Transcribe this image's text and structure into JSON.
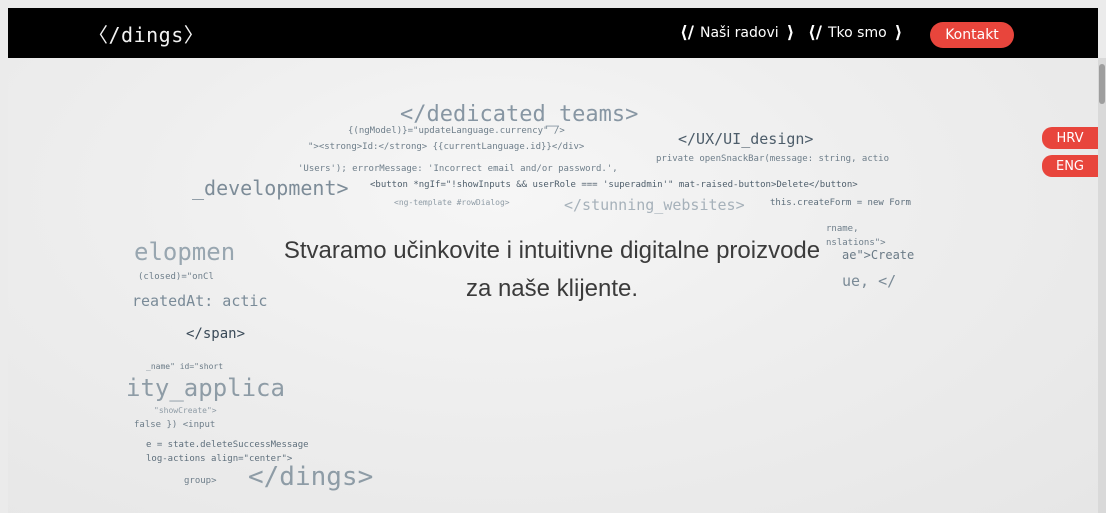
{
  "header": {
    "logo": "〈/dings〉",
    "nav": [
      {
        "prefix": "⟨/",
        "label": "Naši radovi",
        "suffix": "⟩"
      },
      {
        "prefix": "⟨/",
        "label": "Tko smo",
        "suffix": "⟩"
      }
    ],
    "contact_label": "Kontakt"
  },
  "hero": {
    "tagline": "Stvaramo učinkovite i intuitivne digitalne proizvode za naše klijente.",
    "code": {
      "dedicated_teams": "</dedicated_teams>",
      "ux_design": "</UX/UI_design>",
      "development": "_development>",
      "stunning_websites": "</stunning_websites>",
      "developmen": "elopmen",
      "created_at": "reatedAt: actic",
      "span": "</span>",
      "quality": "ity_applica",
      "dings": "</dings>",
      "line1": "{(ngModel)}=\"updateLanguage.currency\" />",
      "line2": "\"><strong>Id:</strong> {{currentLanguage.id}}</div>",
      "line3": "'Users'); errorMessage: 'Incorrect email and/or password.',",
      "line4": "<button *ngIf=\"!showInputs && userRole === 'superadmin'\" mat-raised-button>Delete</button>",
      "line5": "<ng-template #rowDialog>",
      "line6": "private openSnackBar(message: string, actio",
      "line7": "this.createForm = new Form",
      "line8": "rname,",
      "line9": "nslations\">",
      "line10": "ae\">Create",
      "line11": "ue, </",
      "line12": "(closed)=\"onCl",
      "line13": "_name\" id=\"short",
      "line14": "\"showCreate\">",
      "line15": "false }) <input",
      "line16": "e = state.deleteSuccessMessage",
      "line17": "log-actions align=\"center\">",
      "line18": "group>"
    }
  },
  "languages": [
    "HRV",
    "ENG"
  ]
}
